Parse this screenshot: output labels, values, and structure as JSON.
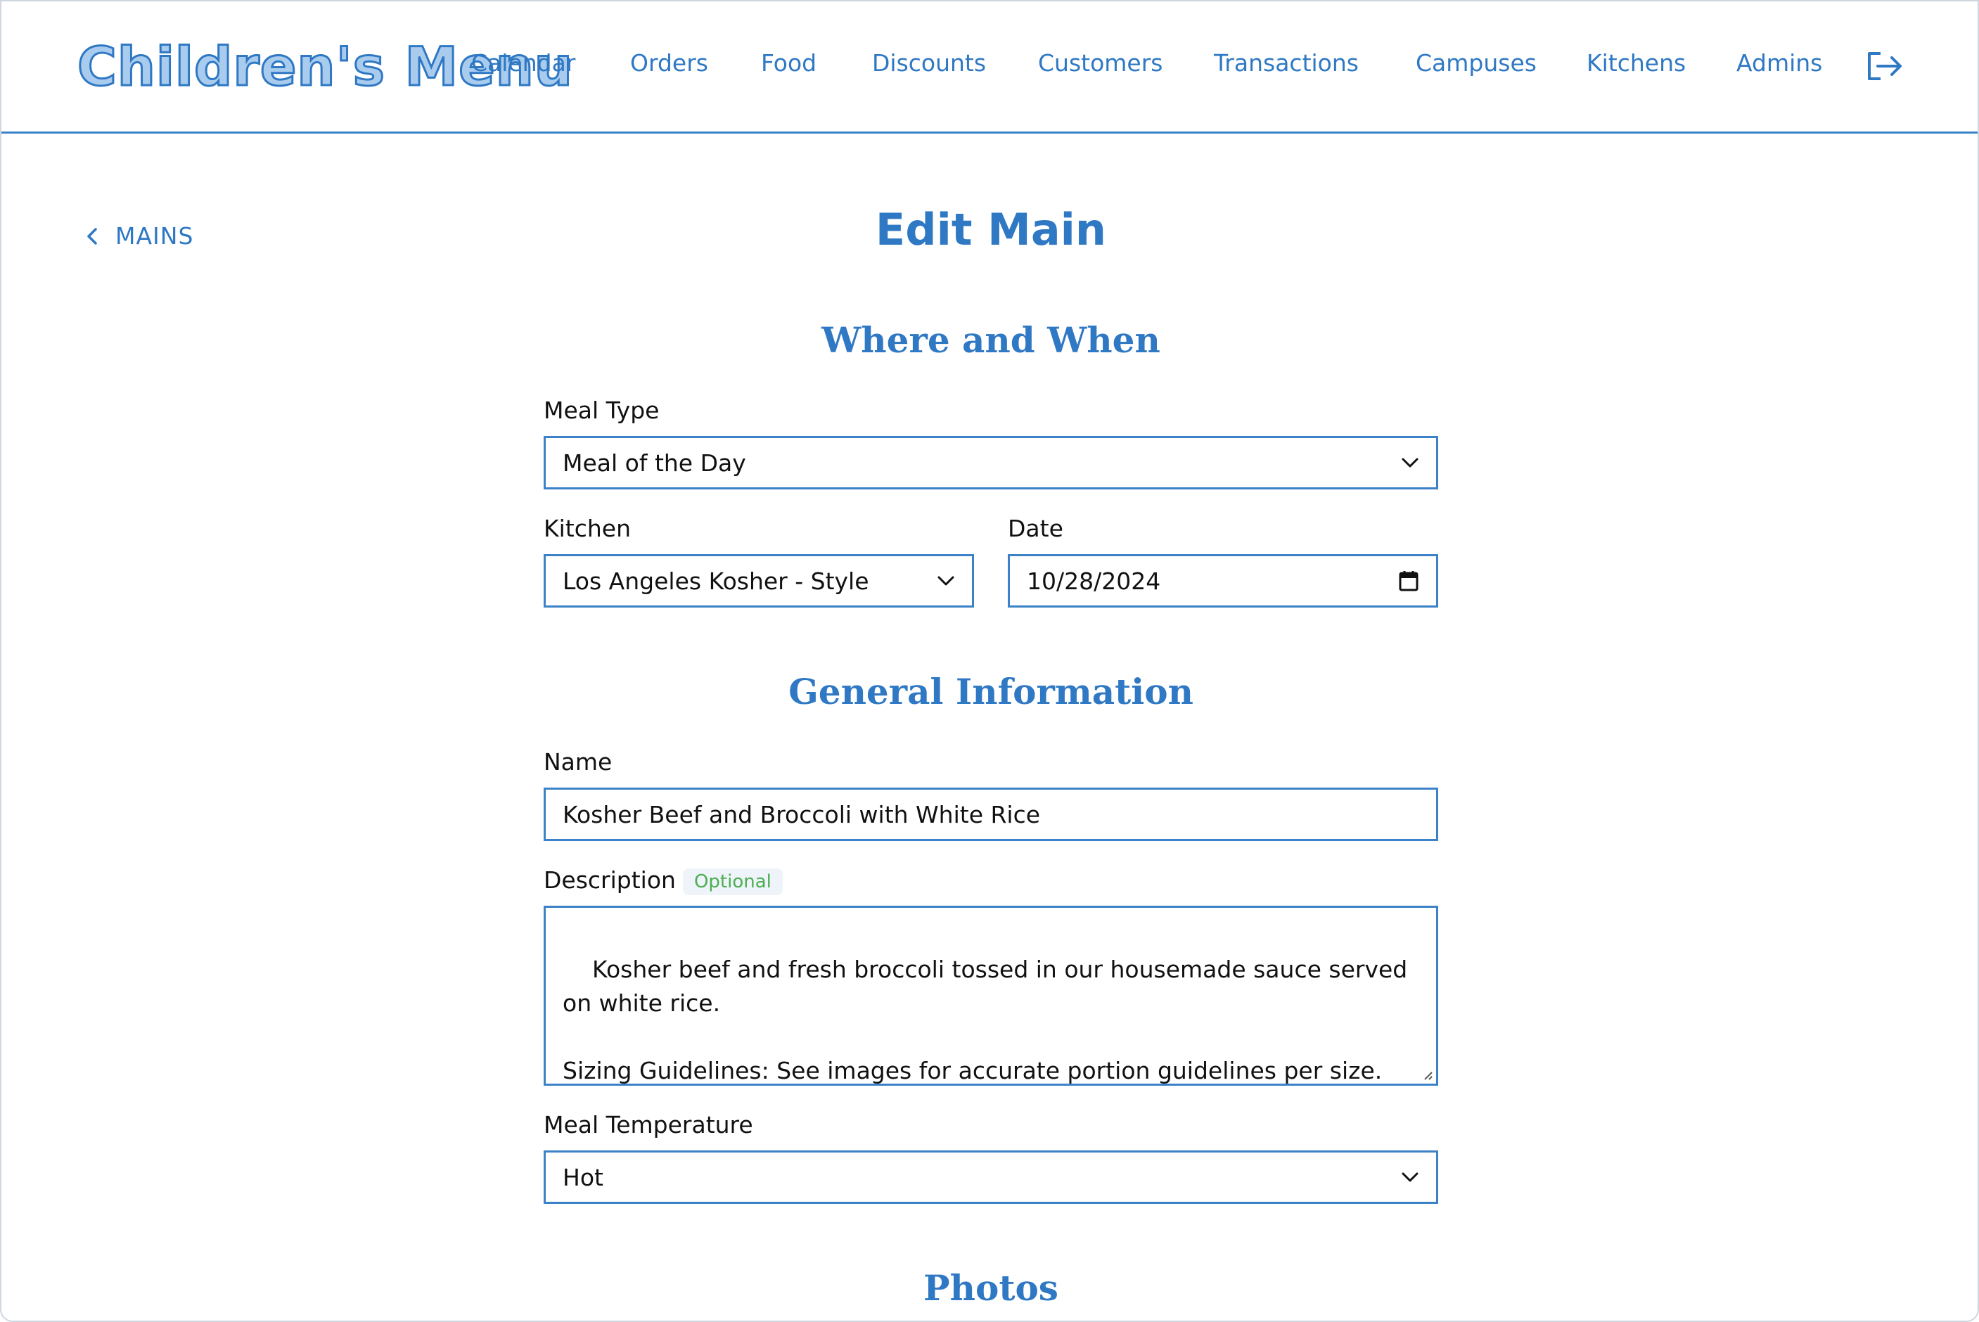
{
  "header": {
    "logo": "Children's Menu",
    "nav": [
      "Calendar",
      "Orders",
      "Food",
      "Discounts",
      "Customers",
      "Transactions",
      "Campuses",
      "Kitchens",
      "Admins"
    ],
    "logout_icon": "logout-icon"
  },
  "back_link": {
    "label": "MAINS",
    "icon": "chevron-left-icon"
  },
  "page_title": "Edit Main",
  "sections": {
    "where_when": "Where and When",
    "general": "General Information",
    "photos": "Photos"
  },
  "form": {
    "meal_type": {
      "label": "Meal Type",
      "value": "Meal of the Day"
    },
    "kitchen": {
      "label": "Kitchen",
      "value": "Los Angeles Kosher - Style"
    },
    "date": {
      "label": "Date",
      "value": "10/28/2024"
    },
    "name": {
      "label": "Name",
      "value": "Kosher Beef and Broccoli with White Rice"
    },
    "description": {
      "label": "Description",
      "badge": "Optional",
      "value": "Kosher beef and fresh broccoli tossed in our housemade sauce served on white rice.\n\nSizing Guidelines: See images for accurate portion guidelines per size."
    },
    "meal_temperature": {
      "label": "Meal Temperature",
      "value": "Hot"
    }
  },
  "colors": {
    "accent": "#2f78c4",
    "border": "#3b82c8",
    "badge_text": "#4caf50"
  }
}
